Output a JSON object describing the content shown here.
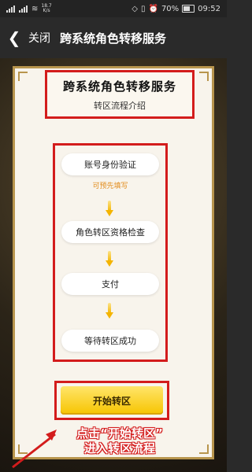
{
  "statusbar": {
    "speed_top": "18.7",
    "speed_bottom": "K/s",
    "battery_pct": "70%",
    "time": "09:52"
  },
  "navbar": {
    "close_label": "关闭",
    "title": "跨系统角色转移服务"
  },
  "header": {
    "title": "跨系统角色转移服务",
    "subtitle": "转区流程介绍"
  },
  "steps": [
    {
      "label": "账号身份验证",
      "note": "可预先填写"
    },
    {
      "label": "角色转区资格检查"
    },
    {
      "label": "支付"
    },
    {
      "label": "等待转区成功"
    }
  ],
  "start_button": {
    "label": "开始转区"
  },
  "annotation": {
    "line1": "点击“开始转区”",
    "line2": "进入转区流程"
  },
  "colors": {
    "highlight": "#d31c1c",
    "button": "#f6c400",
    "note": "#e28b1b",
    "frame": "#b8954d"
  }
}
